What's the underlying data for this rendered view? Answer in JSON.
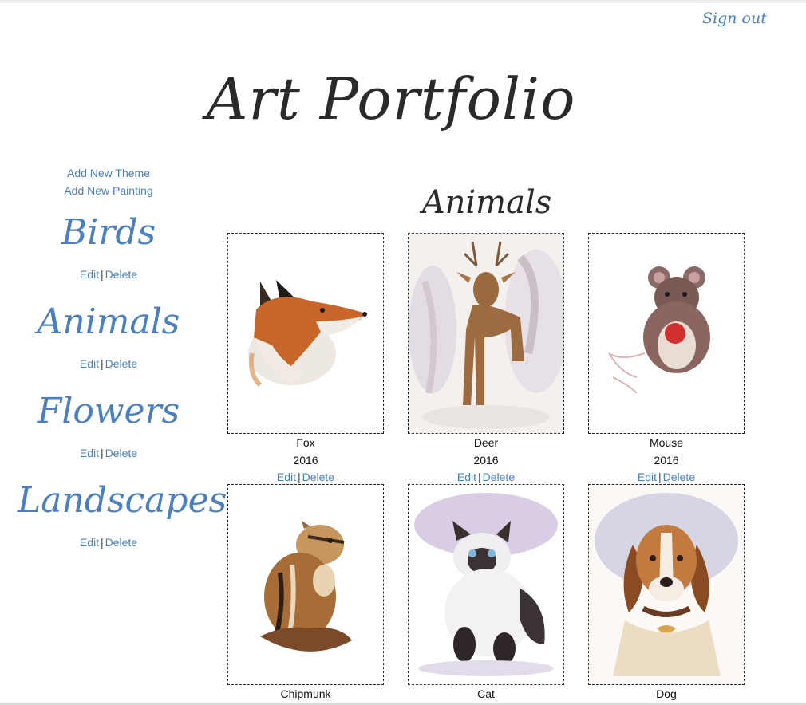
{
  "header": {
    "sign_out": "Sign out",
    "site_title": "Art Portfolio"
  },
  "sidebar": {
    "add_theme": "Add New Theme",
    "add_painting": "Add New Painting",
    "themes": [
      {
        "name": "Birds",
        "edit": "Edit",
        "sep": "|",
        "delete": "Delete"
      },
      {
        "name": "Animals",
        "edit": "Edit",
        "sep": "|",
        "delete": "Delete"
      },
      {
        "name": "Flowers",
        "edit": "Edit",
        "sep": "|",
        "delete": "Delete"
      },
      {
        "name": "Landscapes",
        "edit": "Edit",
        "sep": "|",
        "delete": "Delete"
      }
    ]
  },
  "main": {
    "section_title": "Animals",
    "paintings": [
      {
        "title": "Fox",
        "year": "2016",
        "edit": "Edit",
        "sep": "|",
        "delete": "Delete",
        "icon": "fox-painting"
      },
      {
        "title": "Deer",
        "year": "2016",
        "edit": "Edit",
        "sep": "|",
        "delete": "Delete",
        "icon": "deer-painting"
      },
      {
        "title": "Mouse",
        "year": "2016",
        "edit": "Edit",
        "sep": "|",
        "delete": "Delete",
        "icon": "mouse-painting"
      },
      {
        "title": "Chipmunk",
        "icon": "chipmunk-painting"
      },
      {
        "title": "Cat",
        "icon": "cat-painting"
      },
      {
        "title": "Dog",
        "icon": "dog-painting"
      }
    ]
  },
  "colors": {
    "link": "#4a7fc0",
    "title": "#2a2a2a"
  }
}
